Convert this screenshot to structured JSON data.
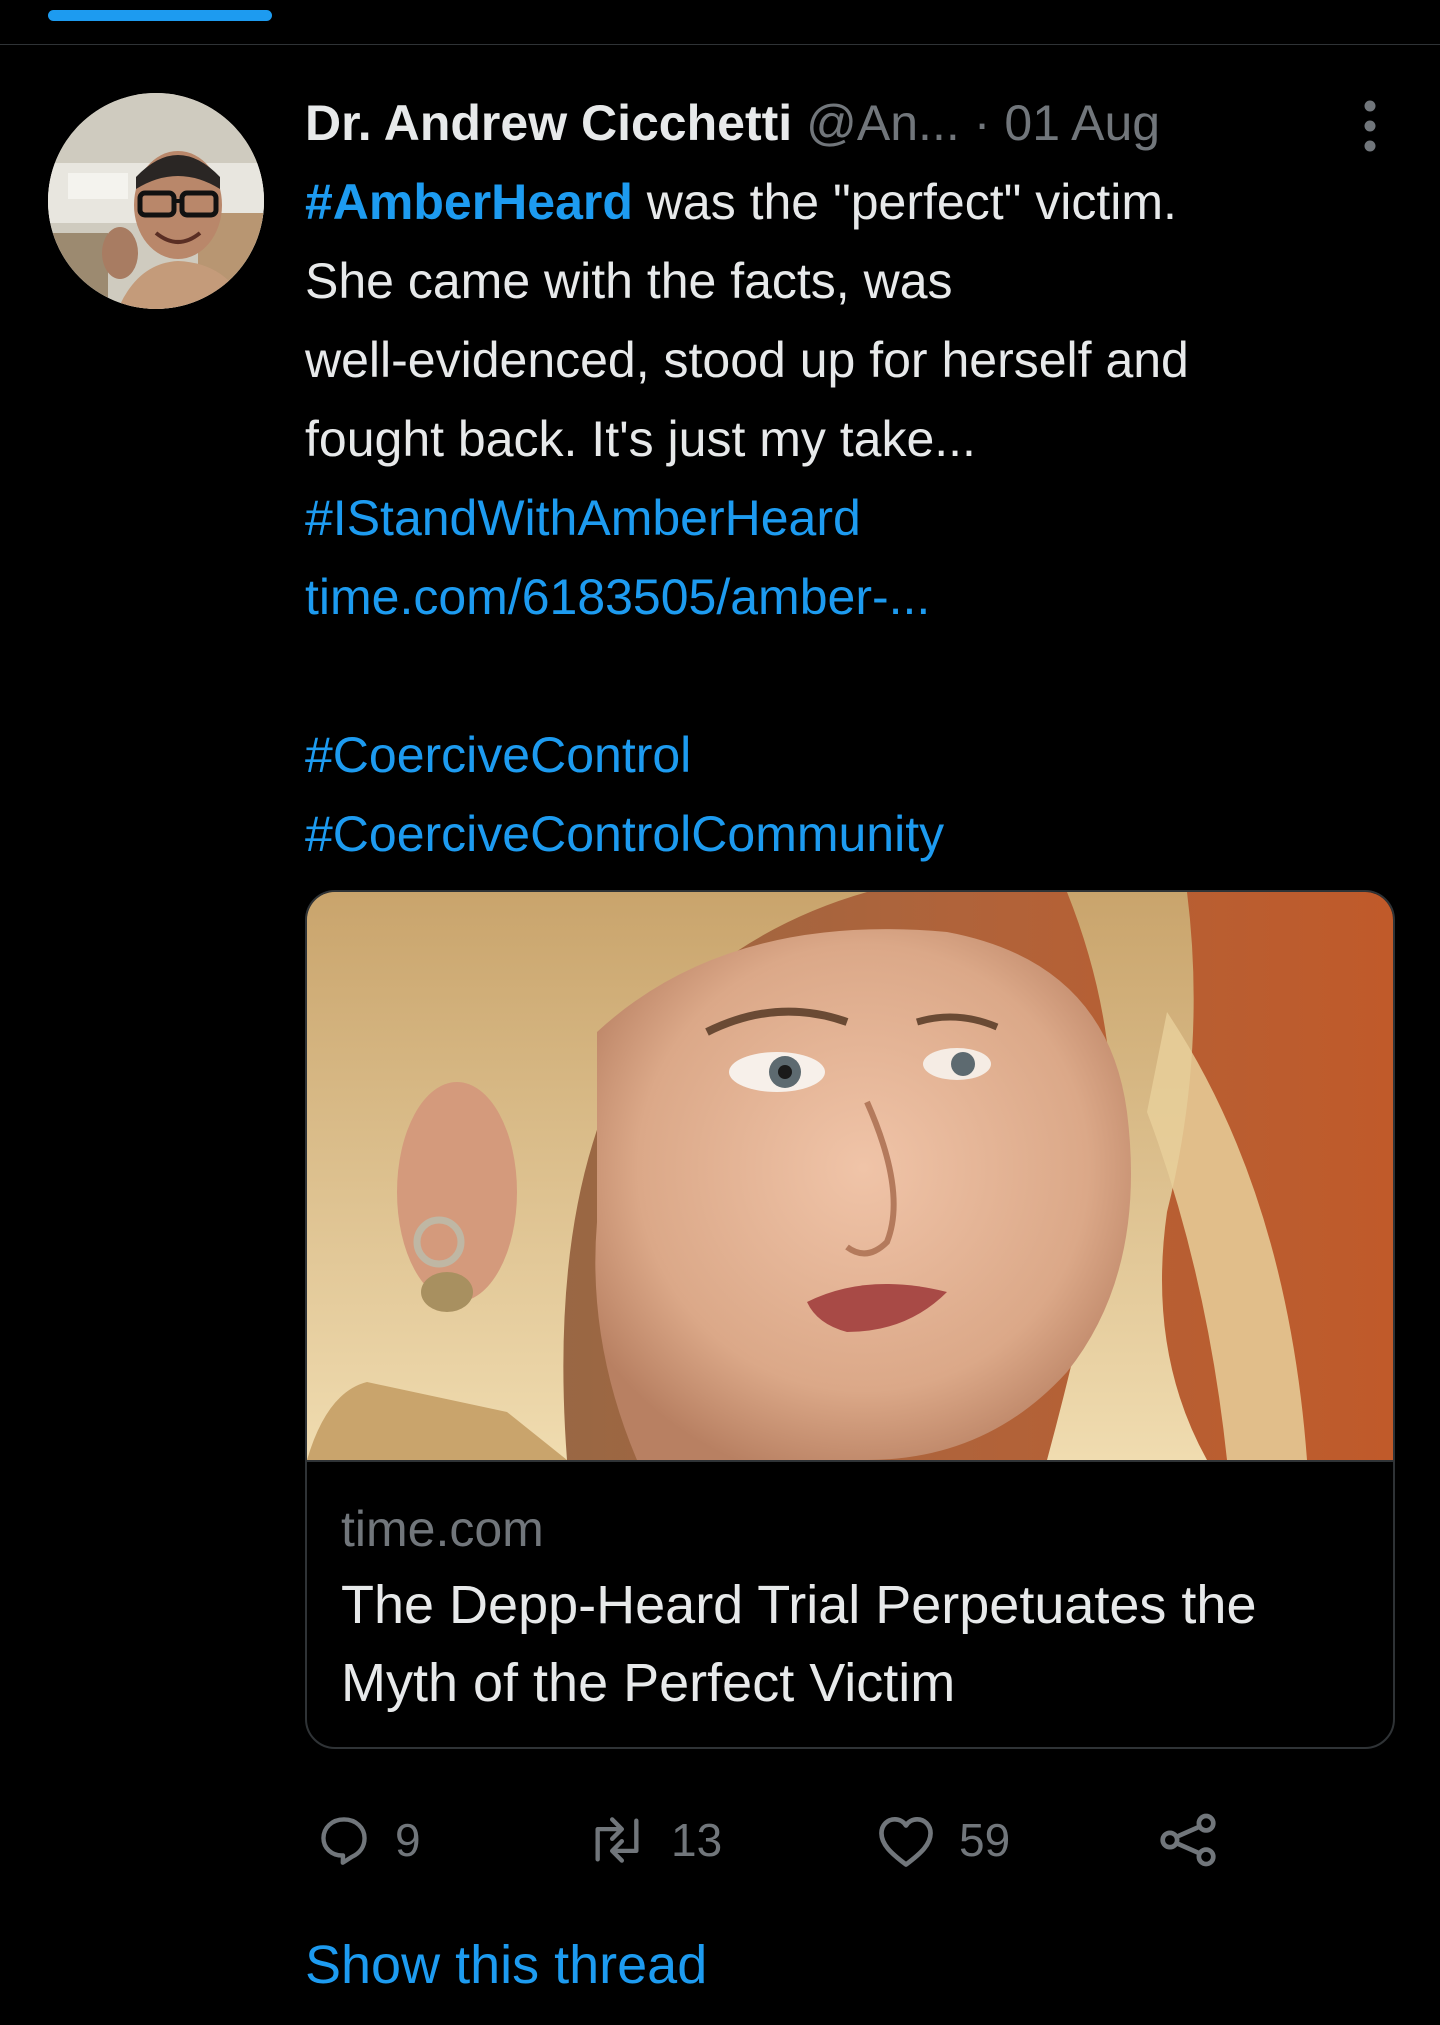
{
  "tweet": {
    "author_name": "Dr. Andrew Cicchetti",
    "handle": "@An...",
    "separator": "·",
    "timestamp": "01 Aug",
    "text_lines": [
      {
        "segments": [
          {
            "text": "#AmberHeard",
            "style": "link-bold"
          },
          {
            "text": " was the \"perfect\" victim.",
            "style": "plain"
          }
        ]
      },
      {
        "segments": [
          {
            "text": "She came with the facts, was",
            "style": "plain"
          }
        ]
      },
      {
        "segments": [
          {
            "text": "well-evidenced, stood up for herself and",
            "style": "plain"
          }
        ]
      },
      {
        "segments": [
          {
            "text": "fought back. It's just my take...",
            "style": "plain"
          }
        ]
      },
      {
        "segments": [
          {
            "text": "#IStandWithAmberHeard",
            "style": "link"
          }
        ]
      },
      {
        "segments": [
          {
            "text": "time.com/6183505/amber-...",
            "style": "link"
          }
        ]
      },
      {
        "segments": []
      },
      {
        "segments": [
          {
            "text": "#CoerciveControl",
            "style": "link"
          }
        ]
      },
      {
        "segments": [
          {
            "text": "#CoerciveControlCommunity",
            "style": "link"
          }
        ]
      }
    ],
    "card": {
      "domain": "time.com",
      "title_lines": [
        "The Depp-Heard Trial Perpetuates the",
        "Myth of the Perfect Victim"
      ]
    },
    "actions": {
      "reply_count": "9",
      "retweet_count": "13",
      "like_count": "59"
    },
    "show_thread": "Show this thread"
  },
  "colors": {
    "background": "#000000",
    "text": "#e7e9ea",
    "secondary": "#71767b",
    "accent": "#1d9bf0",
    "border": "#2f3336"
  },
  "icons": [
    "more-vertical-icon",
    "reply-icon",
    "retweet-icon",
    "like-icon",
    "share-icon"
  ]
}
